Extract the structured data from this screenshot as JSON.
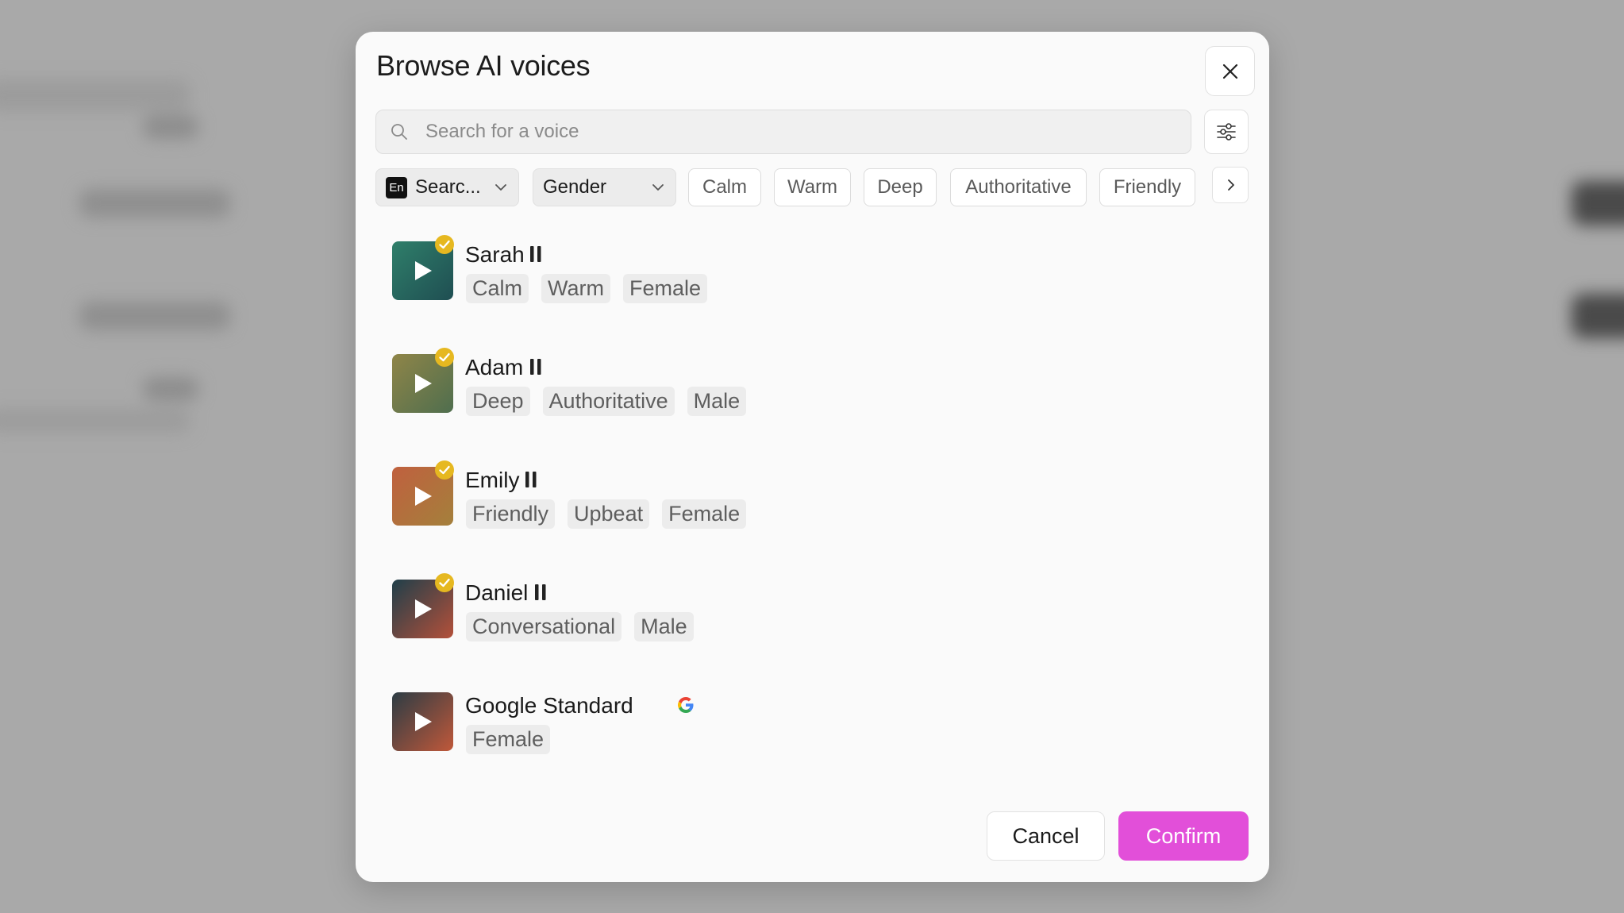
{
  "colors": {
    "accent": "#e24fd9",
    "verified": "#e6b820",
    "tag_bg": "#ececec"
  },
  "dialog": {
    "title": "Browse AI voices",
    "close_icon": "close-icon"
  },
  "search": {
    "placeholder": "Search for a voice",
    "value": "",
    "icon": "search-icon"
  },
  "filters": {
    "language": {
      "badge": "En",
      "label": "Searc..."
    },
    "gender": {
      "label": "Gender"
    },
    "chips": [
      "Calm",
      "Warm",
      "Deep",
      "Authoritative",
      "Friendly"
    ],
    "filter_icon": "sliders-icon",
    "next_icon": "chevron-right-icon"
  },
  "voices": [
    {
      "name": "Sarah",
      "tags": [
        "Calm",
        "Warm",
        "Female"
      ],
      "badge": "pause-icon",
      "verified": true
    },
    {
      "name": "Adam",
      "tags": [
        "Deep",
        "Authoritative",
        "Male"
      ],
      "badge": "pause-icon",
      "verified": true
    },
    {
      "name": "Emily",
      "tags": [
        "Friendly",
        "Upbeat",
        "Female"
      ],
      "badge": "pause-icon",
      "verified": true
    },
    {
      "name": "Daniel",
      "tags": [
        "Conversational",
        "Male"
      ],
      "badge": "pause-icon",
      "verified": true
    },
    {
      "name": "Google Standard",
      "tags": [
        "Female"
      ],
      "badge": "google-icon",
      "verified": false
    }
  ],
  "actions": {
    "cancel_label": "Cancel",
    "confirm_label": "Confirm"
  }
}
